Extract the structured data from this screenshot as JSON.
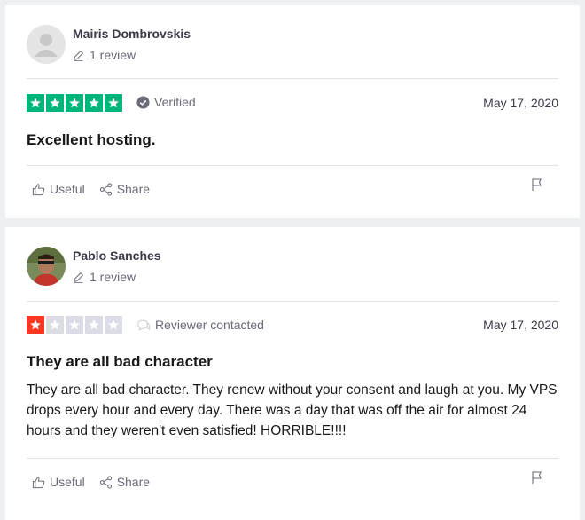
{
  "reviews": [
    {
      "reviewer_name": "Mairis Dombrovskis",
      "review_count": "1 review",
      "rating": 5,
      "star_color": "#00b67a",
      "badge_text": "Verified",
      "badge_icon": "check-circle-icon",
      "date": "May 17, 2020",
      "title": "Excellent hosting.",
      "body": "",
      "useful_label": "Useful",
      "share_label": "Share"
    },
    {
      "reviewer_name": "Pablo Sanches",
      "review_count": "1 review",
      "rating": 1,
      "star_color": "#ff3722",
      "badge_text": "Reviewer contacted",
      "badge_icon": "chat-bubble-icon",
      "date": "May 17, 2020",
      "title": "They are all bad character",
      "body": "They are all bad character. They renew without your consent and laugh at you. My VPS drops every hour and every day. There was a day that was off the air for almost 24 hours and they weren't even satisfied! HORRIBLE!!!!",
      "useful_label": "Useful",
      "share_label": "Share"
    }
  ]
}
